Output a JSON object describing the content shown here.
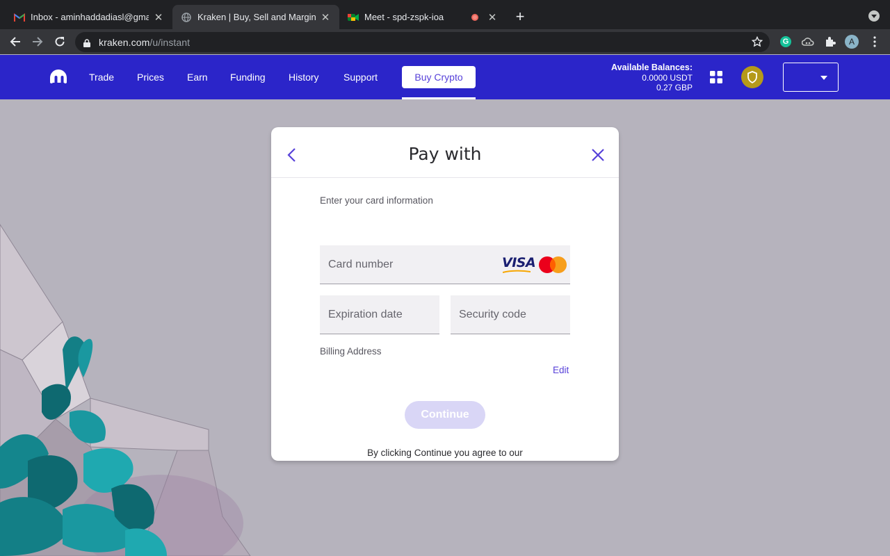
{
  "browser": {
    "tabs": [
      {
        "title": "Inbox - aminhaddadiasl@gmail.com",
        "icon": "gmail-icon"
      },
      {
        "title": "Kraken | Buy, Sell and Margin Trade",
        "icon": "globe-icon"
      },
      {
        "title": "Meet - spd-zspk-ioa",
        "icon": "meet-icon"
      }
    ],
    "url_domain": "kraken.com",
    "url_path": "/u/instant",
    "profile_initial": "A"
  },
  "header": {
    "nav": [
      "Trade",
      "Prices",
      "Earn",
      "Funding",
      "History",
      "Support"
    ],
    "buy_crypto": "Buy Crypto",
    "balances_title": "Available Balances:",
    "balances": [
      "0.0000 USDT",
      "0.27 GBP"
    ]
  },
  "modal": {
    "title": "Pay with",
    "subtitle": "Enter your card information",
    "card_number_placeholder": "Card number",
    "visa_label": "VISA",
    "expiration_placeholder": "Expiration date",
    "security_placeholder": "Security code",
    "billing_label": "Billing Address",
    "edit_label": "Edit",
    "continue_label": "Continue",
    "terms_text": "By clicking Continue you agree to our"
  },
  "colors": {
    "brand": "#2b25c9",
    "accent": "#5741d9",
    "continue_disabled": "#d9d6f6"
  }
}
